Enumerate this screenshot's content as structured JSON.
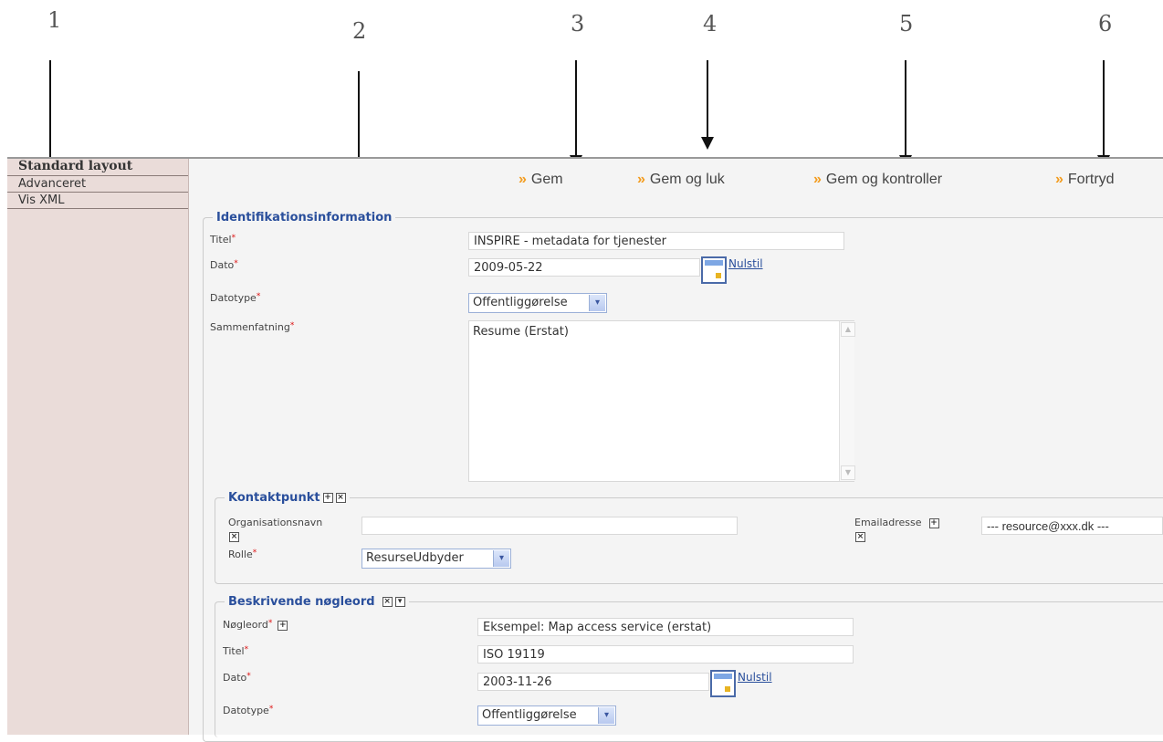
{
  "callouts": [
    "1",
    "2",
    "3",
    "4",
    "5",
    "6"
  ],
  "sidebar": {
    "items": [
      "Standard layout",
      "Advanceret",
      "Vis XML"
    ]
  },
  "toolbar": {
    "gem": "Gem",
    "gem_og_luk": "Gem og luk",
    "gem_og_kontroller": "Gem og kontroller",
    "fortryd": "Fortryd"
  },
  "ident": {
    "legend": "Identifikationsinformation",
    "titel_label": "Titel",
    "titel_value": "INSPIRE - metadata for tjenester",
    "dato_label": "Dato",
    "dato_value": "2009-05-22",
    "nulstil": "Nulstil",
    "datotype_label": "Datotype",
    "datotype_value": "Offentliggørelse",
    "sammenfatning_label": "Sammenfatning",
    "sammenfatning_value": "Resume (Erstat)"
  },
  "kontakt": {
    "legend": "Kontaktpunkt",
    "org_label": "Organisationsnavn",
    "org_value": "",
    "email_label": "Emailadresse",
    "email_value": "--- resource@xxx.dk ---",
    "rolle_label": "Rolle",
    "rolle_value": "ResurseUdbyder"
  },
  "keywords": {
    "legend": "Beskrivende nøgleord",
    "nogleord_label": "Nøgleord",
    "nogleord_value": "Eksempel: Map access service (erstat)",
    "titel_label": "Titel",
    "titel_value": "ISO 19119",
    "dato_label": "Dato",
    "dato_value": "2003-11-26",
    "nulstil": "Nulstil",
    "datotype_label": "Datotype",
    "datotype_value": "Offentliggørelse"
  },
  "icons": {
    "chevron": "»",
    "plus": "+",
    "remove": "×",
    "down": "▾",
    "scroll_up": "▲",
    "scroll_down": "▼"
  }
}
